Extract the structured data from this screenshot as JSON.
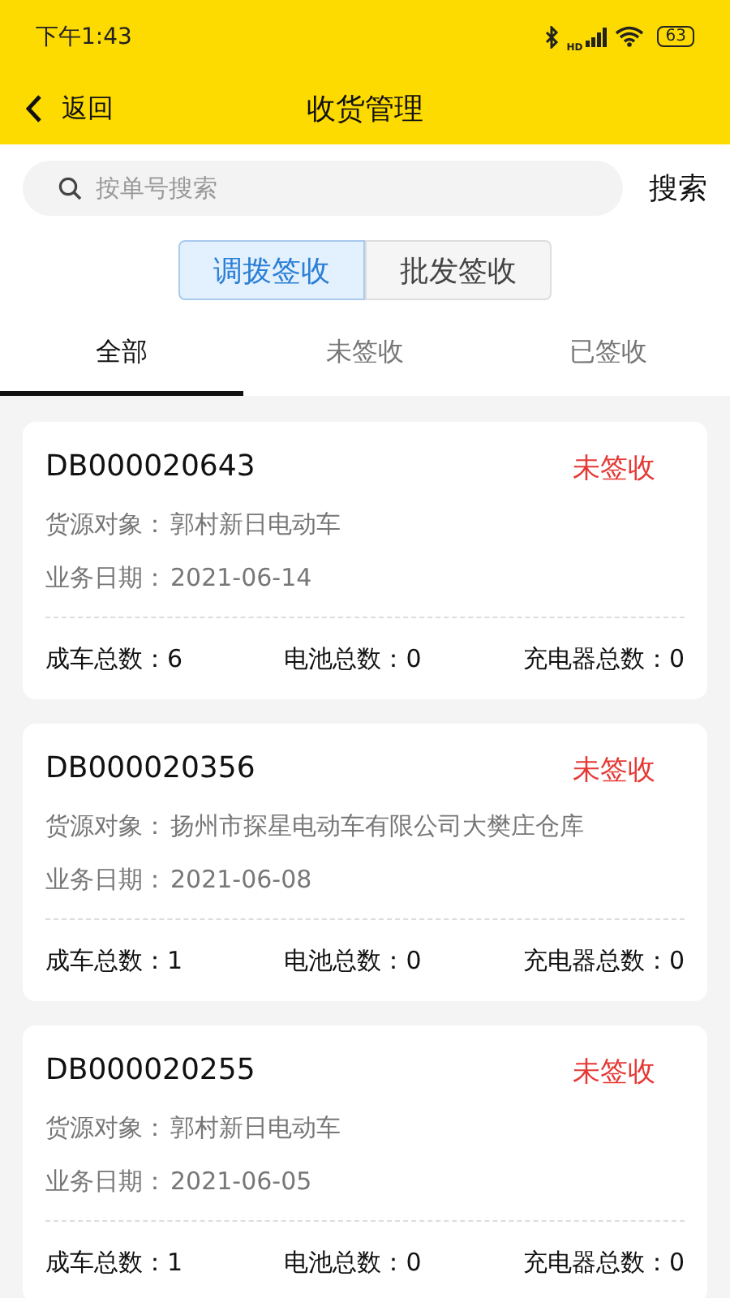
{
  "status_bar": {
    "time": "下午1:43",
    "network_label": "HD",
    "battery": "63"
  },
  "header": {
    "back": "返回",
    "title": "收货管理"
  },
  "search": {
    "placeholder": "按单号搜索",
    "button": "搜索"
  },
  "segments": [
    {
      "label": "调拨签收",
      "selected": true
    },
    {
      "label": "批发签收",
      "selected": false
    }
  ],
  "tabs": [
    {
      "label": "全部",
      "selected": true
    },
    {
      "label": "未签收",
      "selected": false
    },
    {
      "label": "已签收",
      "selected": false
    }
  ],
  "orders": [
    {
      "number": "DB000020643",
      "status": "未签收",
      "signed": false,
      "source_label": "货源对象：",
      "source": "郭村新日电动车",
      "date_label": "业务日期：",
      "date": "2021-06-14",
      "totals": [
        {
          "label": "成车总数：",
          "value": "6"
        },
        {
          "label": "电池总数：",
          "value": "0"
        },
        {
          "label": "充电器总数：",
          "value": "0"
        }
      ]
    },
    {
      "number": "DB000020356",
      "status": "未签收",
      "signed": false,
      "source_label": "货源对象：",
      "source": "扬州市探星电动车有限公司大樊庄仓库",
      "date_label": "业务日期：",
      "date": "2021-06-08",
      "totals": [
        {
          "label": "成车总数：",
          "value": "1"
        },
        {
          "label": "电池总数：",
          "value": "0"
        },
        {
          "label": "充电器总数：",
          "value": "0"
        }
      ]
    },
    {
      "number": "DB000020255",
      "status": "未签收",
      "signed": false,
      "source_label": "货源对象：",
      "source": "郭村新日电动车",
      "date_label": "业务日期：",
      "date": "2021-06-05",
      "totals": [
        {
          "label": "成车总数：",
          "value": "1"
        },
        {
          "label": "电池总数：",
          "value": "0"
        },
        {
          "label": "充电器总数：",
          "value": "0"
        }
      ]
    }
  ]
}
